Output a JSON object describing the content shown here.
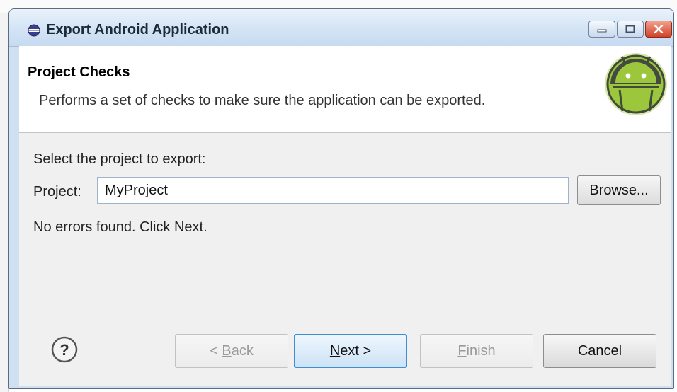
{
  "window": {
    "title": "Export Android Application"
  },
  "header": {
    "title": "Project Checks",
    "description": "Performs a set of checks to make sure the application can be exported."
  },
  "content": {
    "select_label": "Select the project to export:",
    "project_label": "Project:",
    "project_value": "MyProject",
    "browse_label": "Browse...",
    "status_message": "No errors found. Click Next."
  },
  "footer": {
    "back": {
      "prefix": "< ",
      "mnemonic": "B",
      "rest": "ack"
    },
    "next": {
      "mnemonic": "N",
      "rest": "ext >"
    },
    "finish": {
      "mnemonic": "F",
      "rest": "inish"
    },
    "cancel_label": "Cancel"
  },
  "icons": {
    "title": "eclipse-icon",
    "header": "android-logo",
    "help": "help-icon"
  },
  "colors": {
    "title_bar": "#d7e6f6",
    "close_button": "#d0432a",
    "next_focus_border": "#3c8fd1",
    "android_green": "#9cc63b"
  }
}
